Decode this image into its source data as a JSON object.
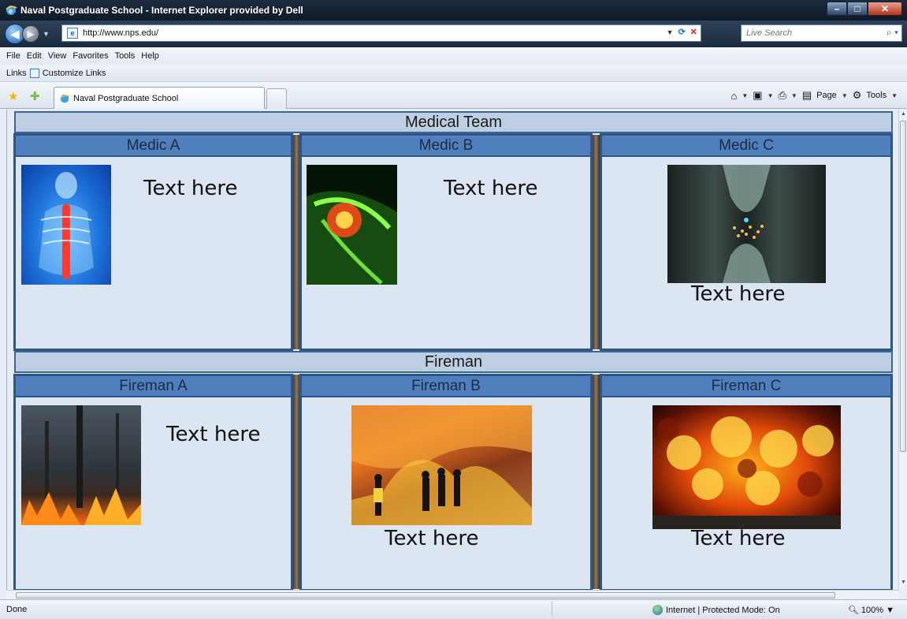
{
  "window": {
    "title": "Naval Postgraduate School - Internet Explorer provided by Dell"
  },
  "address": {
    "url": "http://www.nps.edu/",
    "search_placeholder": "Live Search"
  },
  "menu": [
    "File",
    "Edit",
    "View",
    "Favorites",
    "Tools",
    "Help"
  ],
  "links_bar": {
    "label": "Links",
    "item": "Customize Links"
  },
  "tab": {
    "title": "Naval Postgraduate School"
  },
  "command_bar": {
    "page": "Page",
    "tools": "Tools"
  },
  "slide": {
    "medical": {
      "header": "Medical Team",
      "panels": [
        {
          "title": "Medic A",
          "text": "Text here"
        },
        {
          "title": "Medic B",
          "text": "Text here"
        },
        {
          "title": "Medic C",
          "text": "Text here"
        }
      ]
    },
    "fire": {
      "header": "Fireman",
      "panels": [
        {
          "title": "Fireman A",
          "text": "Text here"
        },
        {
          "title": "Fireman B",
          "text": "Text here"
        },
        {
          "title": "Fireman C",
          "text": "Text here"
        }
      ]
    }
  },
  "status": {
    "left": "Done",
    "zone": "Internet | Protected Mode: On",
    "zoom": "100%"
  }
}
